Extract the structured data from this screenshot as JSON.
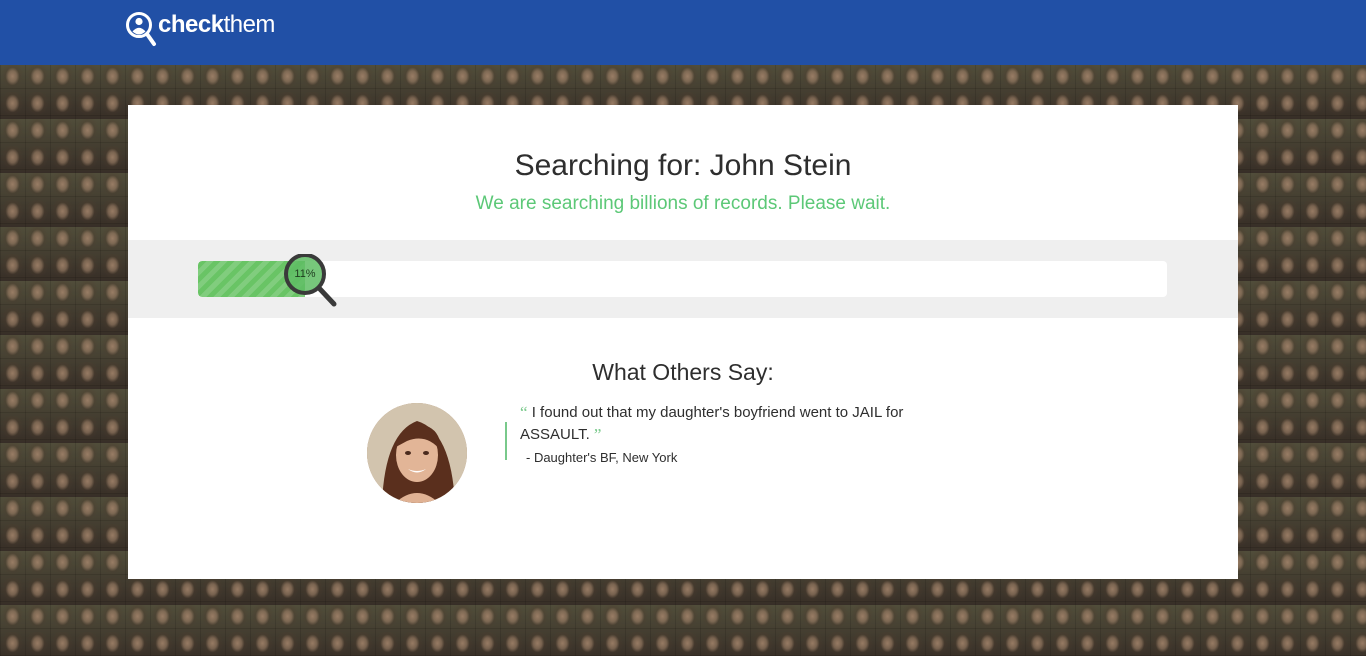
{
  "header": {
    "logo_bold": "check",
    "logo_light": "them",
    "bg_color": "#2150a6"
  },
  "search": {
    "title": "Searching for: John Stein",
    "subtitle": "We are searching billions of records. Please wait.",
    "progress_percent": 11,
    "progress_label": "11%"
  },
  "testimonials": {
    "heading": "What Others Say:",
    "quote": "I found out that my daughter's boyfriend went to JAIL for ASSAULT.",
    "author": "- Daughter's BF, New York",
    "open_quote": "“",
    "close_quote": "”"
  },
  "colors": {
    "accent_green": "#5cc877",
    "progress_green": "#69c465",
    "text_dark": "#2e2e2e"
  },
  "icons": {
    "logo": "person-magnifier-icon",
    "progress": "magnifier-icon"
  }
}
